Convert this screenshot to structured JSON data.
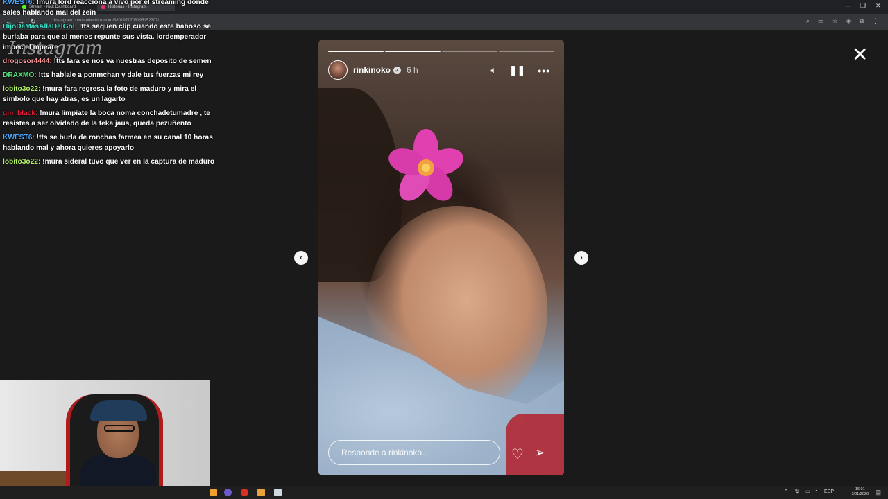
{
  "browser": {
    "tabs": [
      {
        "title": "Stream - Kick Dashboard",
        "color": "#53fc18"
      },
      {
        "title": "Historias • Instagram",
        "color": "#e1306c"
      }
    ],
    "url": "instagram.com/stories/rinkinoko/3801971708195152707/",
    "window_controls": [
      "—",
      "❐",
      "✕"
    ]
  },
  "instagram": {
    "logo": "Instagram"
  },
  "chat": [
    {
      "user": "KWEST6:",
      "color": "#4aa8ff",
      "text": " !mura lord reacciona a vivo por el streaming donde sales hablando mal del zein"
    },
    {
      "user": "HijoDeMasAllaDelGol:",
      "color": "#3fe0c8",
      "text": " !tts saquen clip cuando este baboso se burlaba para que al menos repunte sus vista. lordemperador impec el mpeare"
    },
    {
      "user": "drogosor4444:",
      "color": "#ff9999",
      "text": " !tts fara se nos va nuestras deposito de semen"
    },
    {
      "user": "DRAXMO:",
      "color": "#55e07a",
      "text": " !tts hablale a ponmchan y dale tus fuerzas mi rey"
    },
    {
      "user": "lobito3o22:",
      "color": "#b6f56c",
      "text": " !mura fara regresa la foto de maduro y mira el simbolo que hay atras, es un lagarto"
    },
    {
      "user": "gm_black:",
      "color": "#e0203a",
      "text": " !mura limpiate la boca noma conchadetumadre , te resistes a ser olvidado de la feka jaus, queda pezuñento"
    },
    {
      "user": "KWEST6:",
      "color": "#4aa8ff",
      "text": " !tts se burla de ronchas farmea en su canal 10 horas hablando mal y ahora quieres apoyarlo"
    },
    {
      "user": "lobito3o22:",
      "color": "#b6f56c",
      "text": " !mura sideral tuvo que ver en la captura de maduro"
    }
  ],
  "story": {
    "username": "rinkinoko",
    "time": "6 h",
    "progress_segments": 4,
    "progress_done": 2,
    "reply_placeholder": "Responde a rinkinoko..."
  },
  "taskbar": {
    "language": "ESP",
    "time": "16:01",
    "date": "3/01/2026"
  }
}
